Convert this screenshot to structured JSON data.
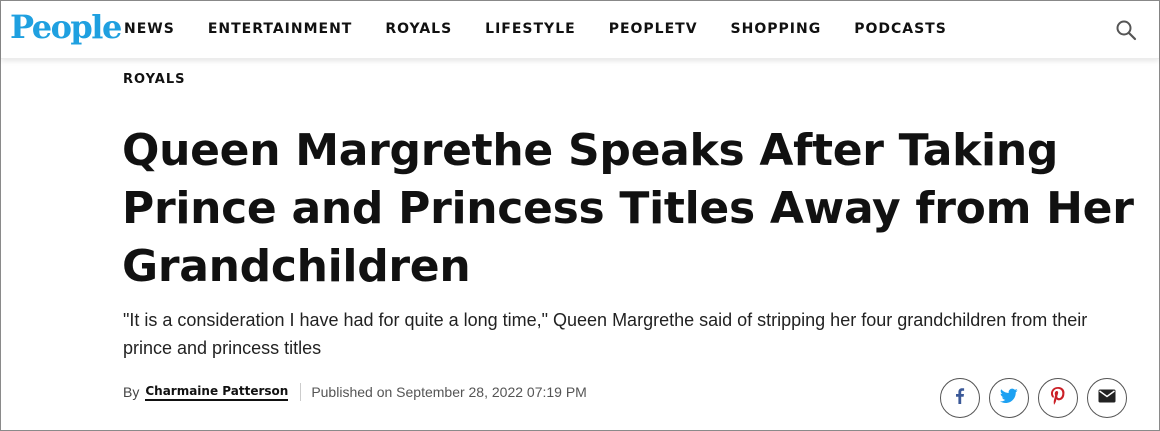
{
  "brand": {
    "logo_text": "People",
    "logo_color": "#1fa0e0"
  },
  "nav": {
    "items": [
      {
        "label": "NEWS"
      },
      {
        "label": "ENTERTAINMENT"
      },
      {
        "label": "ROYALS"
      },
      {
        "label": "LIFESTYLE"
      },
      {
        "label": "PEOPLETV"
      },
      {
        "label": "SHOPPING"
      },
      {
        "label": "PODCASTS"
      }
    ],
    "search_icon": "search-icon"
  },
  "article": {
    "category": "ROYALS",
    "headline": "Queen Margrethe Speaks After Taking Prince and Princess Titles Away from Her Grandchildren",
    "dek": "\"It is a consideration I have had for quite a long time,\" Queen Margrethe said of stripping her four grandchildren from their prince and princess titles",
    "byline": {
      "by_label": "By",
      "author": "Charmaine Patterson",
      "published": "Published on September 28, 2022 07:19 PM"
    }
  },
  "share": {
    "buttons": [
      {
        "icon": "facebook-icon",
        "color": "#3b5998"
      },
      {
        "icon": "twitter-icon",
        "color": "#1da1f2"
      },
      {
        "icon": "pinterest-icon",
        "color": "#cb2027"
      },
      {
        "icon": "email-icon",
        "color": "#222222"
      }
    ]
  }
}
